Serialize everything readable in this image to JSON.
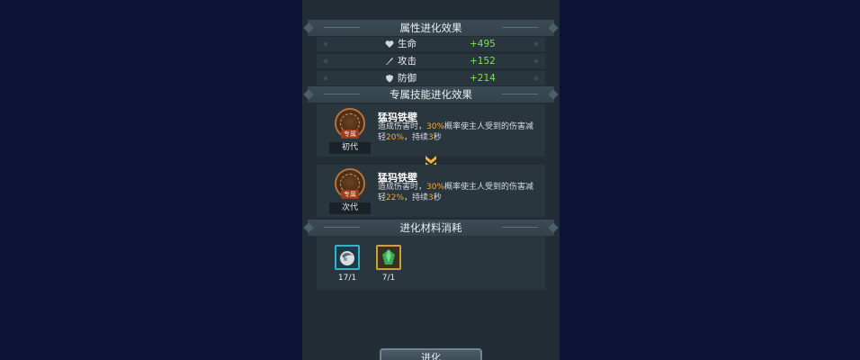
{
  "attributes": {
    "header": "属性进化效果",
    "rows": [
      {
        "name": "生命",
        "value": "+495",
        "icon": "heart-icon"
      },
      {
        "name": "攻击",
        "value": "+152",
        "icon": "sword-icon"
      },
      {
        "name": "防御",
        "value": "+214",
        "icon": "shield-icon"
      }
    ]
  },
  "skills": {
    "header": "专属技能进化效果",
    "cards": [
      {
        "tag": "专属",
        "generation": "初代",
        "title": "猛犸铁壁",
        "desc_a": "造成伤害时，",
        "pct1": "30%",
        "desc_b": "概率使主人受到的伤害减轻",
        "pct2": "20%",
        "desc_c": "，持续",
        "dur": "3",
        "desc_d": "秒"
      },
      {
        "tag": "专属",
        "generation": "次代",
        "title": "猛犸铁壁",
        "desc_a": "造成伤害时，",
        "pct1": "30%",
        "desc_b": "概率使主人受到的伤害减轻",
        "pct2": "22%",
        "desc_c": "，持续",
        "dur": "3",
        "desc_d": "秒"
      }
    ]
  },
  "materials": {
    "header": "进化材料消耗",
    "items": [
      {
        "count": "17/1",
        "icon": "material-orb-icon"
      },
      {
        "count": "7/1",
        "icon": "green-gem-icon"
      }
    ]
  },
  "evolve_button": "进化",
  "colors": {
    "accent": "#f2a93b",
    "bonus": "#7ee050",
    "panel": "#222d35",
    "background": "#0e1235"
  }
}
